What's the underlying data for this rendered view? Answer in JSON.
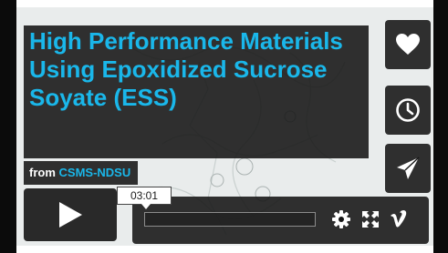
{
  "video": {
    "title": "High Performance Materials Using Epoxidized Sucrose Soyate (ESS)",
    "byline_prefix": "from",
    "byline_owner": "CSMS-NDSU"
  },
  "side_buttons": [
    {
      "icon": "heart-icon"
    },
    {
      "icon": "clock-icon"
    },
    {
      "icon": "send-icon"
    }
  ],
  "player": {
    "play_icon": "play-icon",
    "time_tooltip": "03:01",
    "progress": 0.0,
    "controls": [
      "gear-icon",
      "fullscreen-icon",
      "vimeo-logo-icon"
    ]
  },
  "colors": {
    "accent": "#1ab7ea",
    "overlay": "#141414",
    "background": "#e9ecec"
  }
}
